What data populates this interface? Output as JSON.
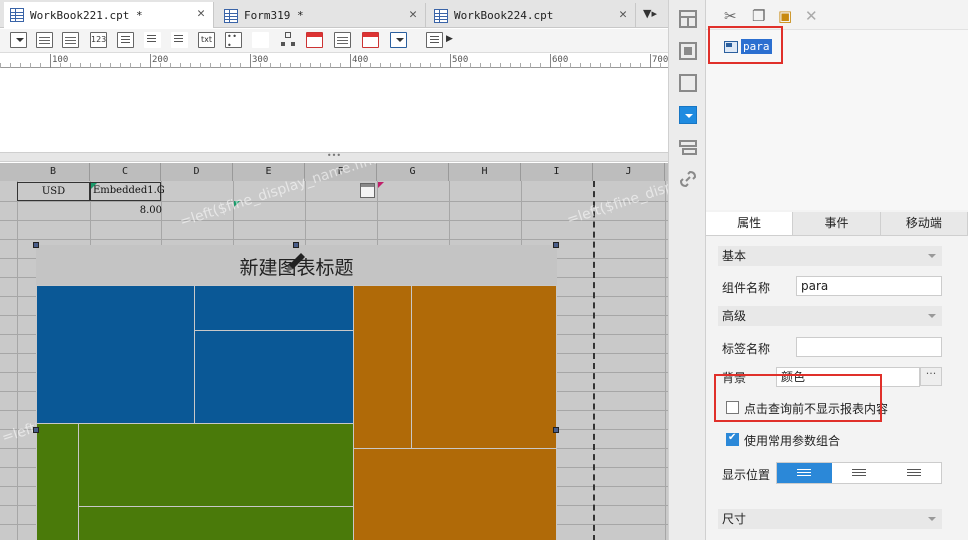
{
  "tabs": [
    {
      "label": "WorkBook221.cpt *",
      "active": true
    },
    {
      "label": "Form319 *",
      "active": false
    },
    {
      "label": "WorkBook224.cpt",
      "active": false
    }
  ],
  "ruler": {
    "labels": [
      "100",
      "200",
      "300",
      "400",
      "500",
      "600",
      "700"
    ]
  },
  "sheet": {
    "columns": [
      "B",
      "C",
      "D",
      "E",
      "F",
      "G",
      "H",
      "I",
      "J"
    ],
    "cells": {
      "usd": "USD",
      "embedded": "Embedded1.G",
      "amount": "8.00"
    },
    "watermark": "=left($fine_display_name.find(\"(\"),1)"
  },
  "chart": {
    "title": "新建图表标题",
    "colors": {
      "blue": "#0a5896",
      "orange": "#b06a08",
      "green": "#4a7a0a"
    }
  },
  "side_icons": [
    "layout-icon",
    "widget-icon",
    "frame-icon",
    "dropdown-icon",
    "param-icon",
    "link-icon"
  ],
  "widget_tree": {
    "item": "para"
  },
  "property_tabs": [
    "属性",
    "事件",
    "移动端"
  ],
  "properties": {
    "basic_section": "基本",
    "name_label": "组件名称",
    "name_value": "para",
    "advanced_section": "高级",
    "tag_label": "标签名称",
    "tag_value": "",
    "background_label": "背景",
    "background_value": "颜色",
    "more_button": "···",
    "hide_before_query": "点击查询前不显示报表内容",
    "use_common_params": "使用常用参数组合",
    "position_label": "显示位置",
    "size_section": "尺寸"
  },
  "accent_color": "#2b88d8",
  "highlight_color": "#e0302a"
}
